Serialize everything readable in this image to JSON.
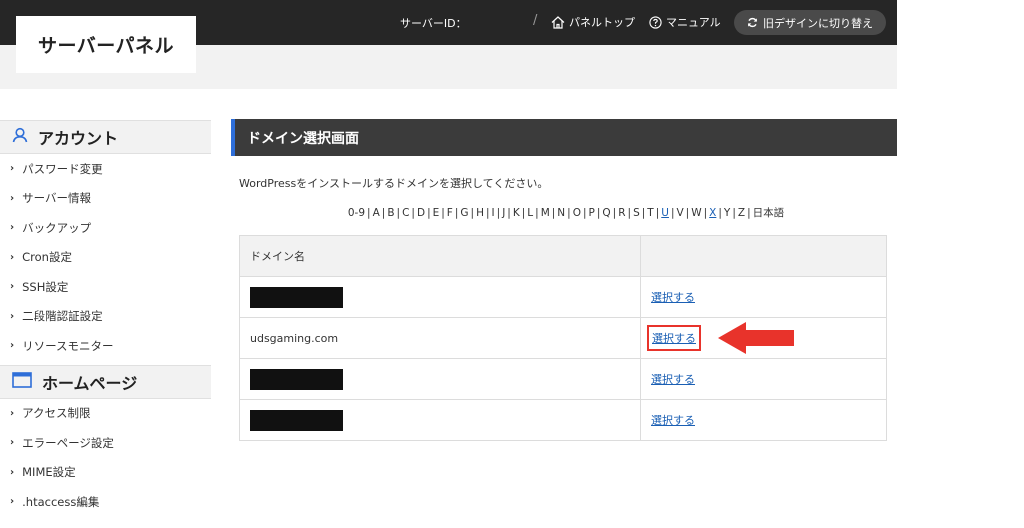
{
  "header": {
    "logo": "サーバーパネル",
    "server_id_label": "サーバーID：",
    "separator": "/",
    "panel_top": "パネルトップ",
    "manual": "マニュアル",
    "old_design": "旧デザインに切り替え"
  },
  "sidebar": {
    "account": {
      "title": "アカウント",
      "items": [
        {
          "label": "パスワード変更"
        },
        {
          "label": "サーバー情報"
        },
        {
          "label": "バックアップ"
        },
        {
          "label": "Cron設定"
        },
        {
          "label": "SSH設定"
        },
        {
          "label": "二段階認証設定"
        },
        {
          "label": "リソースモニター"
        }
      ]
    },
    "homepage": {
      "title": "ホームページ",
      "items": [
        {
          "label": "アクセス制限"
        },
        {
          "label": "エラーページ設定"
        },
        {
          "label": "MIME設定"
        },
        {
          "label": ".htaccess編集"
        }
      ]
    }
  },
  "main": {
    "title": "ドメイン選択画面",
    "instruction": "WordPressをインストールするドメインを選択してください。",
    "alphabet": [
      "0-9",
      "A",
      "B",
      "C",
      "D",
      "E",
      "F",
      "G",
      "H",
      "I",
      "J",
      "K",
      "L",
      "M",
      "N",
      "O",
      "P",
      "Q",
      "R",
      "S",
      "T",
      "U",
      "V",
      "W",
      "X",
      "Y",
      "Z",
      "日本語"
    ],
    "alphabet_links": [
      "U",
      "X"
    ],
    "table": {
      "header": {
        "domain": "ドメイン名",
        "action": ""
      },
      "rows": [
        {
          "domain": "",
          "redacted": true,
          "action": "選択する"
        },
        {
          "domain": "udsgaming.com",
          "redacted": false,
          "action": "選択する",
          "highlighted": true
        },
        {
          "domain": "",
          "redacted": true,
          "action": "選択する"
        },
        {
          "domain": "",
          "redacted": true,
          "action": "選択する"
        }
      ]
    }
  },
  "icons": {
    "account": "person-icon",
    "homepage": "window-icon",
    "panel_top": "home-icon",
    "manual": "help-circle-icon",
    "old_design": "refresh-icon",
    "annotation": "red-arrow-icon"
  },
  "colors": {
    "header_bg": "#262626",
    "accent_blue": "#2e6ed8",
    "link": "#1a5fb4",
    "highlight_red": "#e8332b"
  }
}
